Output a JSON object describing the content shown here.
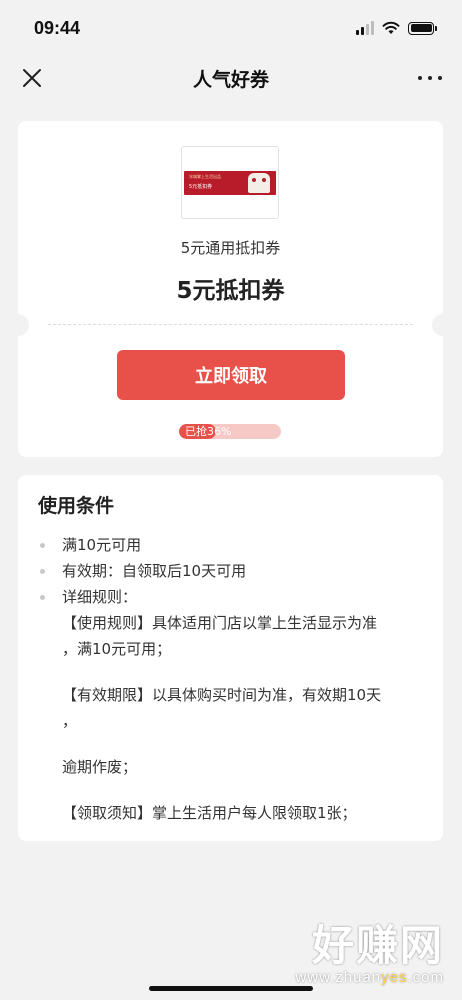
{
  "status_bar": {
    "time": "09:44",
    "icons": [
      "signal-icon",
      "wifi-icon",
      "battery-icon"
    ]
  },
  "nav": {
    "title": "人气好券",
    "close_icon": "close-icon",
    "more_icon": "more-icon"
  },
  "coupon": {
    "thumb_line1": "冰城掌上生活出品",
    "thumb_line2": "5元抵扣券",
    "subtitle": "5元通用抵扣券",
    "name": "5元抵扣券",
    "claim_button": "立即领取",
    "progress_text": "已抢36%",
    "progress_percent": 36,
    "accent_color": "#e8514a"
  },
  "conditions": {
    "title": "使用条件",
    "items": [
      "满10元可用",
      "有效期：自领取后10天可用",
      "详细规则："
    ],
    "rules": [
      "【使用规则】具体适用门店以掌上生活显示为准",
      "，满10元可用；",
      "【有效期限】以具体购买时间为准，有效期10天",
      "，",
      "逾期作废；",
      "【领取须知】掌上生活用户每人限领取1张；"
    ]
  },
  "watermark": {
    "big": "好赚网",
    "small_a": "www.zhuan",
    "small_b": "yes",
    "small_c": ".com"
  }
}
